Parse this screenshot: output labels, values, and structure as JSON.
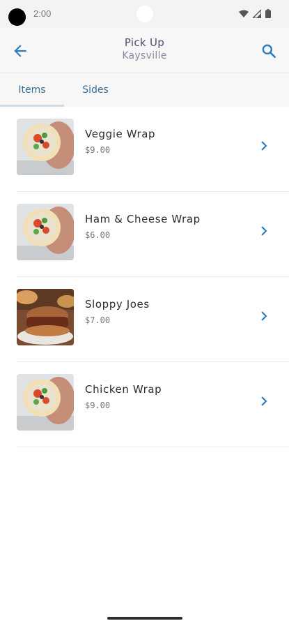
{
  "status_bar": {
    "time": "2:00"
  },
  "header": {
    "title": "Pick Up",
    "subtitle": "Kaysville"
  },
  "tabs": [
    {
      "label": "Items"
    },
    {
      "label": "Sides"
    }
  ],
  "items": [
    {
      "name": "Veggie Wrap",
      "price": "$9.00",
      "image": "wrap-photo"
    },
    {
      "name": "Ham & Cheese Wrap",
      "price": "$6.00",
      "image": "wrap-photo"
    },
    {
      "name": "Sloppy Joes",
      "price": "$7.00",
      "image": "sandwich-photo"
    },
    {
      "name": "Chicken Wrap",
      "price": "$9.00",
      "image": "wrap-photo"
    }
  ],
  "colors": {
    "accent": "#2f7bbf",
    "tab_text": "#3a6e9a",
    "title": "#4e4e6a"
  }
}
